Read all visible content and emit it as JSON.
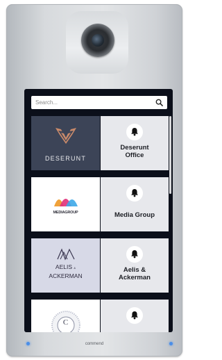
{
  "device": {
    "brand": "commend",
    "led_color": "#4a8ee8"
  },
  "search": {
    "placeholder": "Search...",
    "icon": "search-icon"
  },
  "directory": [
    {
      "logo_text": "DESERUNT",
      "name": "Deserunt Office",
      "name_lines": [
        "Deserunt",
        "Office"
      ],
      "logo_bg": "#3c4457",
      "icon": "bell-icon"
    },
    {
      "logo_text": "MEDIAGROUP",
      "name": "Media Group",
      "name_lines": [
        "Media Group"
      ],
      "logo_bg": "#ffffff",
      "icon": "bell-icon"
    },
    {
      "logo_text": "AELIS & ACKERMAN",
      "logo_lines": [
        "AELIS",
        "ACKERMAN"
      ],
      "logo_ampersand": "&",
      "name": "Aelis & Ackerman",
      "name_lines": [
        "Aelis &",
        "Ackerman"
      ],
      "logo_bg": "#d7d9e7",
      "icon": "bell-icon"
    },
    {
      "logo_text": "C",
      "name": "",
      "name_lines": [],
      "logo_bg": "#ffffff",
      "icon": "bell-icon"
    }
  ]
}
